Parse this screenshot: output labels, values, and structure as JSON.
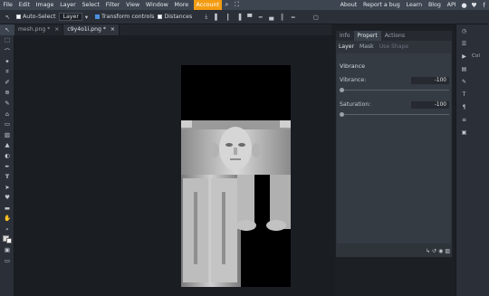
{
  "menubar": {
    "items": [
      "File",
      "Edit",
      "Image",
      "Layer",
      "Select",
      "Filter",
      "View",
      "Window",
      "More"
    ],
    "account": "Account",
    "right_links": [
      "About",
      "Report a bug",
      "Learn",
      "Blog",
      "API"
    ]
  },
  "options": {
    "auto_select": "Auto-Select",
    "layer_select": "Layer",
    "transform_controls": "Transform controls",
    "distances": "Distances"
  },
  "doc_tabs": [
    {
      "name": "mesh.png *",
      "close": "×"
    },
    {
      "name": "c9y4o1i.png *",
      "close": "×"
    }
  ],
  "panel": {
    "tabs": [
      "Info",
      "Propert",
      "Actions"
    ],
    "subtabs": [
      "Layer",
      "Mask",
      "Use Shape"
    ],
    "title": "Vibrance",
    "vibrance_label": "Vibrance:",
    "vibrance_value": "-100",
    "saturation_label": "Saturation:",
    "saturation_value": "-100"
  },
  "rightbar": {
    "col_label": "Col"
  },
  "colors": {
    "accent": "#f39c12",
    "menubar": "#3d4550",
    "panel": "#2f343b"
  }
}
